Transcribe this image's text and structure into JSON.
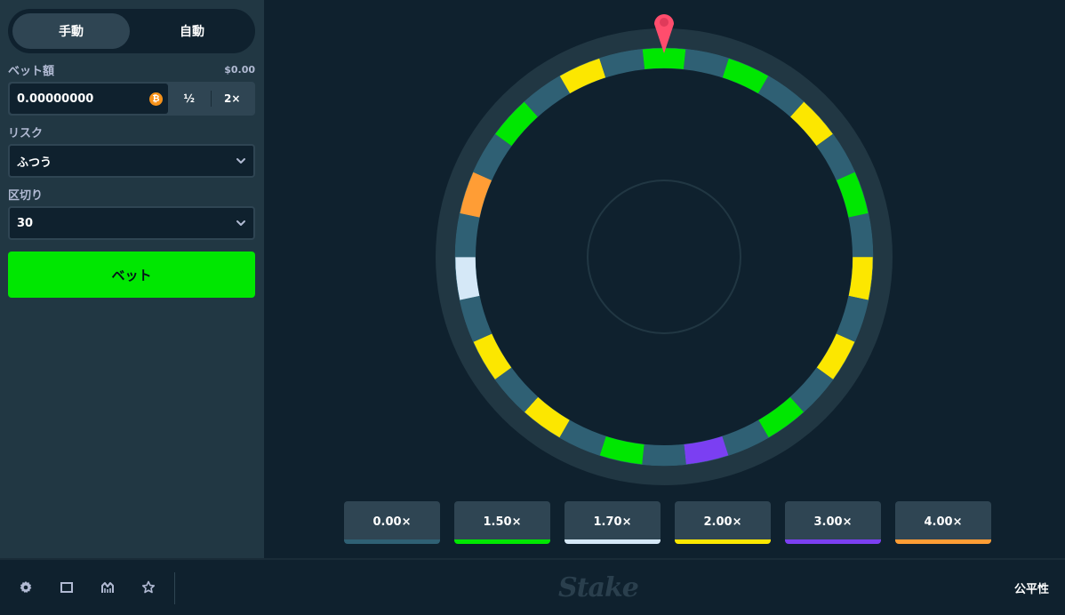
{
  "sidebar": {
    "modes": [
      {
        "label": "手動",
        "active": true
      },
      {
        "label": "自動",
        "active": false
      }
    ],
    "bet_amount": {
      "label": "ベット額",
      "usd_value": "$0.00",
      "value": "0.00000000",
      "currency_icon": "bitcoin-icon",
      "currency_glyph": "₿",
      "half_label": "½",
      "double_label": "2×"
    },
    "risk": {
      "label": "リスク",
      "value": "ふつう"
    },
    "segments": {
      "label": "区切り",
      "value": "30"
    },
    "bet_button_label": "ベット"
  },
  "wheel": {
    "segment_count": 30,
    "pointer_color": "#ff4d6d",
    "segment_colors": [
      "#00e701",
      "#2f6074",
      "#00e701",
      "#2f6074",
      "#fce700",
      "#2f6074",
      "#00e701",
      "#2f6074",
      "#fce700",
      "#2f6074",
      "#fce700",
      "#2f6074",
      "#00e701",
      "#2f6074",
      "#7b3ff2",
      "#2f6074",
      "#00e701",
      "#2f6074",
      "#fce700",
      "#2f6074",
      "#fce700",
      "#2f6074",
      "#d5e8f7",
      "#2f6074",
      "#ff9d35",
      "#2f6074",
      "#00e701",
      "#2f6074",
      "#fce700",
      "#2f6074"
    ]
  },
  "multipliers": [
    {
      "label": "0.00×",
      "color": "#2f6074"
    },
    {
      "label": "1.50×",
      "color": "#00e701"
    },
    {
      "label": "1.70×",
      "color": "#d5e8f7"
    },
    {
      "label": "2.00×",
      "color": "#fce700"
    },
    {
      "label": "3.00×",
      "color": "#7b3ff2"
    },
    {
      "label": "4.00×",
      "color": "#ff9d35"
    }
  ],
  "footer": {
    "icons": [
      "settings-icon",
      "theatre-mode-icon",
      "stats-icon",
      "favorite-icon"
    ],
    "logo_text": "Stake",
    "fairness_label": "公平性"
  }
}
